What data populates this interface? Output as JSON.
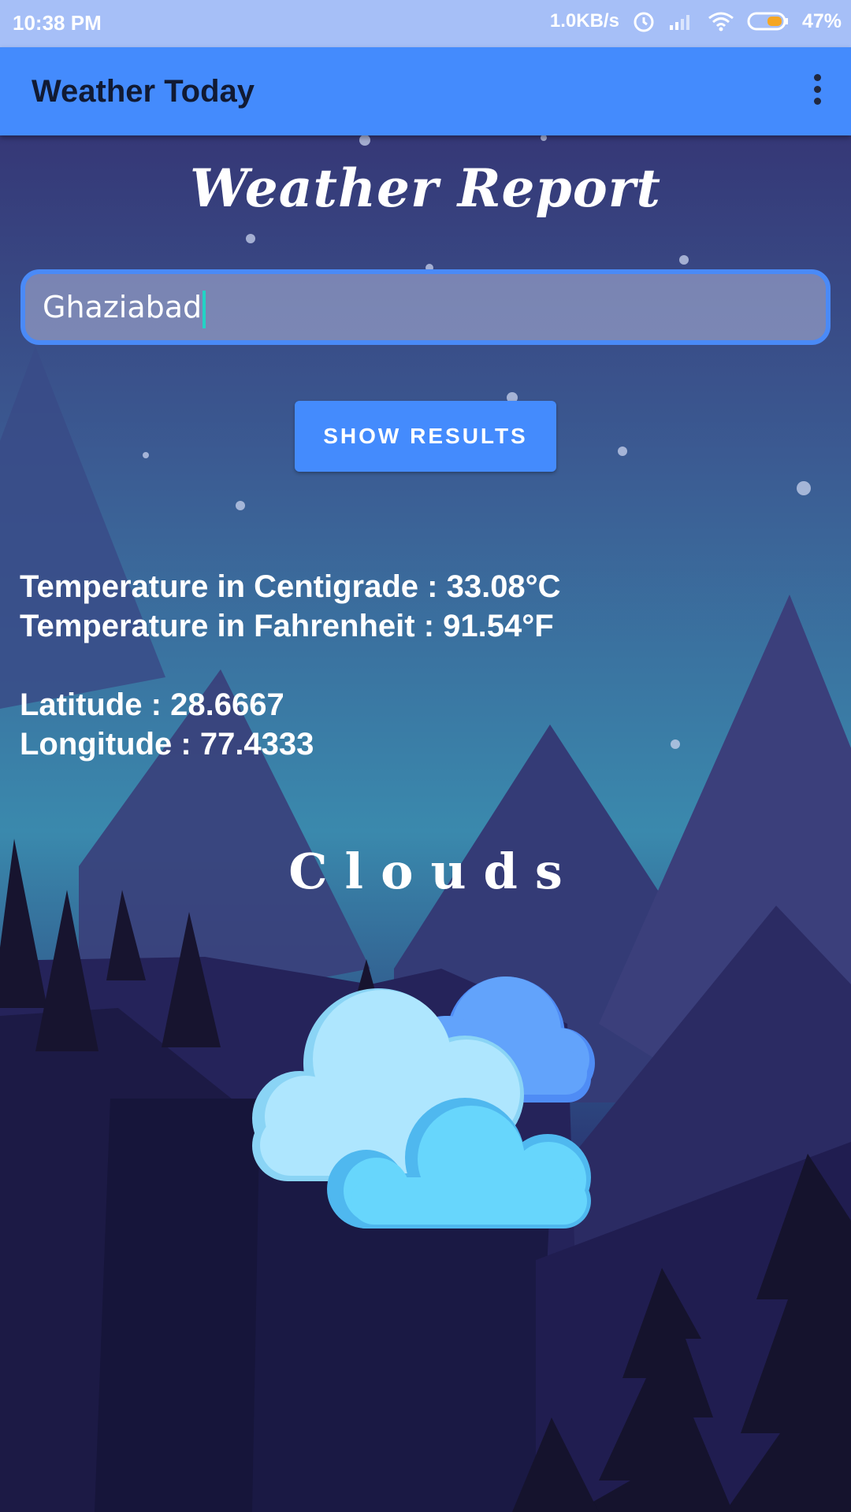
{
  "status_bar": {
    "time": "10:38 PM",
    "network_speed": "1.0KB/s",
    "battery_percent": "47%",
    "icons": [
      "alarm-icon",
      "signal-icon",
      "wifi-icon",
      "battery-icon"
    ]
  },
  "app_bar": {
    "title": "Weather Today",
    "menu_icon": "overflow-menu-icon"
  },
  "page": {
    "heading": "Weather Report",
    "city_input_value": "Ghaziabad",
    "button_label": "SHOW RESULTS"
  },
  "results": {
    "temp_celsius": "Temperature in Centigrade : 33.08°C",
    "temp_fahrenheit": "Temperature in Fahrenheit : 91.54°F",
    "latitude": "Latitude : 28.6667",
    "longitude": "Longitude : 77.4333",
    "condition": "Clouds",
    "condition_icon": "clouds-icon"
  },
  "colors": {
    "status_bar": "#a6bff7",
    "app_bar": "#448bfd",
    "accent": "#448bfd",
    "caret": "#22d3c5"
  }
}
